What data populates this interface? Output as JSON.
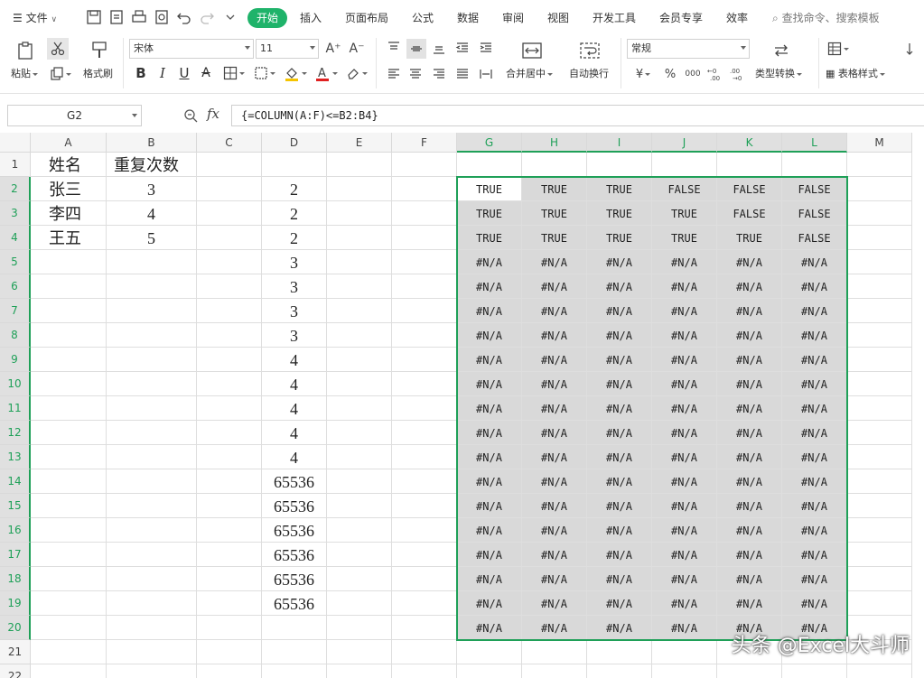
{
  "menubar": {
    "file_label": "文件",
    "tabs": [
      "开始",
      "插入",
      "页面布局",
      "公式",
      "数据",
      "审阅",
      "视图",
      "开发工具",
      "会员专享",
      "效率"
    ],
    "search_placeholder": "查找命令、搜索模板"
  },
  "ribbon": {
    "paste_label": "粘贴",
    "format_painter_label": "格式刷",
    "font_name": "宋体",
    "font_size": "11",
    "merge_label": "合并居中",
    "wrap_label": "自动换行",
    "number_format": "常规",
    "convert_label": "类型转换",
    "table_style_label": "表格样式",
    "currency_symbol": "¥",
    "percent_symbol": "%",
    "thousands_symbol": "000"
  },
  "formula_bar": {
    "name_box": "G2",
    "fx_label": "fx",
    "formula": "{=COLUMN(A:F)<=B2:B4}"
  },
  "sheet": {
    "columns": [
      "A",
      "B",
      "C",
      "D",
      "E",
      "F",
      "G",
      "H",
      "I",
      "J",
      "K",
      "L",
      "M"
    ],
    "rows": [
      "1",
      "2",
      "3",
      "4",
      "5",
      "6",
      "7",
      "8",
      "9",
      "10",
      "11",
      "12",
      "13",
      "14",
      "15",
      "16",
      "17",
      "18",
      "19",
      "20",
      "21",
      "22"
    ],
    "col_a": [
      "姓名",
      "张三",
      "李四",
      "王五"
    ],
    "col_b": [
      "重复次数",
      "3",
      "4",
      "5"
    ],
    "col_d": [
      "",
      "2",
      "2",
      "2",
      "3",
      "3",
      "3",
      "3",
      "4",
      "4",
      "4",
      "4",
      "4",
      "65536",
      "65536",
      "65536",
      "65536",
      "65536",
      "65536"
    ],
    "result": [
      [
        "TRUE",
        "TRUE",
        "TRUE",
        "FALSE",
        "FALSE",
        "FALSE"
      ],
      [
        "TRUE",
        "TRUE",
        "TRUE",
        "TRUE",
        "FALSE",
        "FALSE"
      ],
      [
        "TRUE",
        "TRUE",
        "TRUE",
        "TRUE",
        "TRUE",
        "FALSE"
      ],
      [
        "#N/A",
        "#N/A",
        "#N/A",
        "#N/A",
        "#N/A",
        "#N/A"
      ],
      [
        "#N/A",
        "#N/A",
        "#N/A",
        "#N/A",
        "#N/A",
        "#N/A"
      ],
      [
        "#N/A",
        "#N/A",
        "#N/A",
        "#N/A",
        "#N/A",
        "#N/A"
      ],
      [
        "#N/A",
        "#N/A",
        "#N/A",
        "#N/A",
        "#N/A",
        "#N/A"
      ],
      [
        "#N/A",
        "#N/A",
        "#N/A",
        "#N/A",
        "#N/A",
        "#N/A"
      ],
      [
        "#N/A",
        "#N/A",
        "#N/A",
        "#N/A",
        "#N/A",
        "#N/A"
      ],
      [
        "#N/A",
        "#N/A",
        "#N/A",
        "#N/A",
        "#N/A",
        "#N/A"
      ],
      [
        "#N/A",
        "#N/A",
        "#N/A",
        "#N/A",
        "#N/A",
        "#N/A"
      ],
      [
        "#N/A",
        "#N/A",
        "#N/A",
        "#N/A",
        "#N/A",
        "#N/A"
      ],
      [
        "#N/A",
        "#N/A",
        "#N/A",
        "#N/A",
        "#N/A",
        "#N/A"
      ],
      [
        "#N/A",
        "#N/A",
        "#N/A",
        "#N/A",
        "#N/A",
        "#N/A"
      ],
      [
        "#N/A",
        "#N/A",
        "#N/A",
        "#N/A",
        "#N/A",
        "#N/A"
      ],
      [
        "#N/A",
        "#N/A",
        "#N/A",
        "#N/A",
        "#N/A",
        "#N/A"
      ],
      [
        "#N/A",
        "#N/A",
        "#N/A",
        "#N/A",
        "#N/A",
        "#N/A"
      ],
      [
        "#N/A",
        "#N/A",
        "#N/A",
        "#N/A",
        "#N/A",
        "#N/A"
      ],
      [
        "#N/A",
        "#N/A",
        "#N/A",
        "#N/A",
        "#N/A",
        "#N/A"
      ]
    ],
    "selected_columns": [
      "G",
      "H",
      "I",
      "J",
      "K",
      "L"
    ],
    "accent_color": "#1fa058"
  },
  "watermark": "头条 @Excel大斗师",
  "icons": {
    "menu": "hamburger-icon",
    "save": "save-icon",
    "undo": "undo-icon",
    "redo": "redo-icon",
    "search": "search-icon",
    "fx": "function-icon",
    "zoom": "zoom-icon"
  }
}
